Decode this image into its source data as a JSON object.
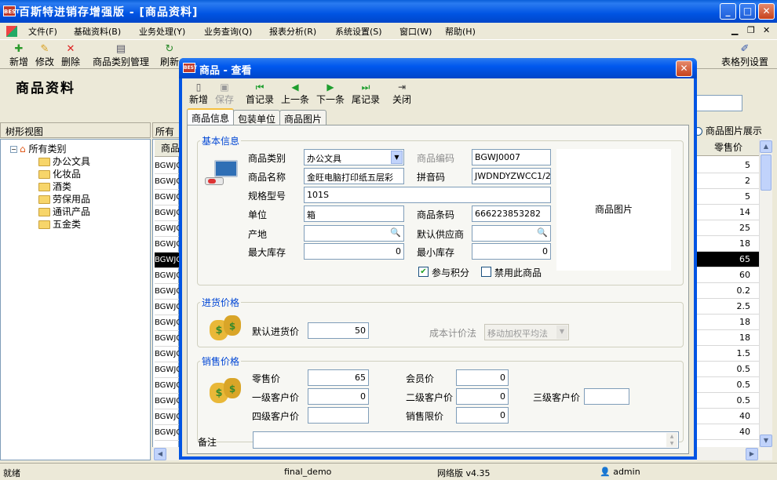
{
  "app": {
    "title": "百斯特进销存增强版 - [商品资料]",
    "logo_text": "BEST",
    "menu": [
      "文件(F)",
      "基础资料(B)",
      "业务处理(Y)",
      "业务查询(Q)",
      "报表分析(R)",
      "系统设置(S)",
      "窗口(W)",
      "帮助(H)"
    ],
    "toolbar": {
      "add": "新增",
      "edit": "修改",
      "delete": "删除",
      "category": "商品类别管理",
      "refresh": "刷新",
      "column_settings": "表格列设置"
    },
    "page_title": "商品资料",
    "tree_header": "树形视图",
    "tree": {
      "root": "所有类别",
      "items": [
        "办公文具",
        "化妆品",
        "酒类",
        "劳保用品",
        "通讯产品",
        "五金类"
      ]
    },
    "grid_header": "所有类",
    "grid_col": "商品",
    "grid_codes": [
      "BGWJO",
      "BGWJO",
      "BGWJO",
      "BGWJO",
      "BGWJO",
      "BGWJO",
      "BGWJO",
      "BGWJO",
      "BGWJO",
      "BGWJO",
      "BGWJO",
      "BGWJO",
      "BGWJO",
      "BGWJO",
      "BGWJO",
      "BGWJO",
      "BGWJO",
      "BGWJO"
    ],
    "right_header": "商品图片展示",
    "price_col": "零售价",
    "prices": [
      "5",
      "2",
      "5",
      "14",
      "25",
      "18",
      "65",
      "60",
      "0.2",
      "2.5",
      "18",
      "18",
      "1.5",
      "0.5",
      "0.5",
      "0.5",
      "40",
      "40"
    ],
    "status": {
      "ready": "就绪",
      "db": "final_demo",
      "version": "网络版 v4.35",
      "user": "admin"
    }
  },
  "dialog": {
    "title": "商品 - 查看",
    "toolbar": {
      "new": "新增",
      "save": "保存",
      "first": "首记录",
      "prev": "上一条",
      "next": "下一条",
      "last": "尾记录",
      "close": "关闭"
    },
    "tabs": [
      "商品信息",
      "包装单位",
      "商品图片"
    ],
    "basic": {
      "title": "基本信息",
      "category_label": "商品类别",
      "category": "办公文具",
      "code_label": "商品编码",
      "code": "BGWJ0007",
      "name_label": "商品名称",
      "name": "金旺电脑打印纸五层彩",
      "pinyin_label": "拼音码",
      "pinyin": "JWDNDYZWCC1/2",
      "spec_label": "规格型号",
      "spec": "101S",
      "unit_label": "单位",
      "unit": "箱",
      "barcode_label": "商品条码",
      "barcode": "666223853282",
      "origin_label": "产地",
      "origin": "",
      "supplier_label": "默认供应商",
      "supplier": "",
      "max_label": "最大库存",
      "max": "0",
      "min_label": "最小库存",
      "min": "0",
      "points_label": "参与积分",
      "disable_label": "禁用此商品",
      "image_label": "商品图片"
    },
    "purchase": {
      "title": "进货价格",
      "default_label": "默认进货价",
      "default": "50",
      "cost_label": "成本计价法",
      "cost": "移动加权平均法"
    },
    "sales": {
      "title": "销售价格",
      "retail_label": "零售价",
      "retail": "65",
      "member_label": "会员价",
      "member": "0",
      "l1_label": "一级客户价",
      "l1": "0",
      "l2_label": "二级客户价",
      "l2": "0",
      "l3_label": "三级客户价",
      "l3": "",
      "l4_label": "四级客户价",
      "l4": "",
      "limit_label": "销售限价",
      "limit": "0"
    },
    "remark_label": "备注"
  }
}
